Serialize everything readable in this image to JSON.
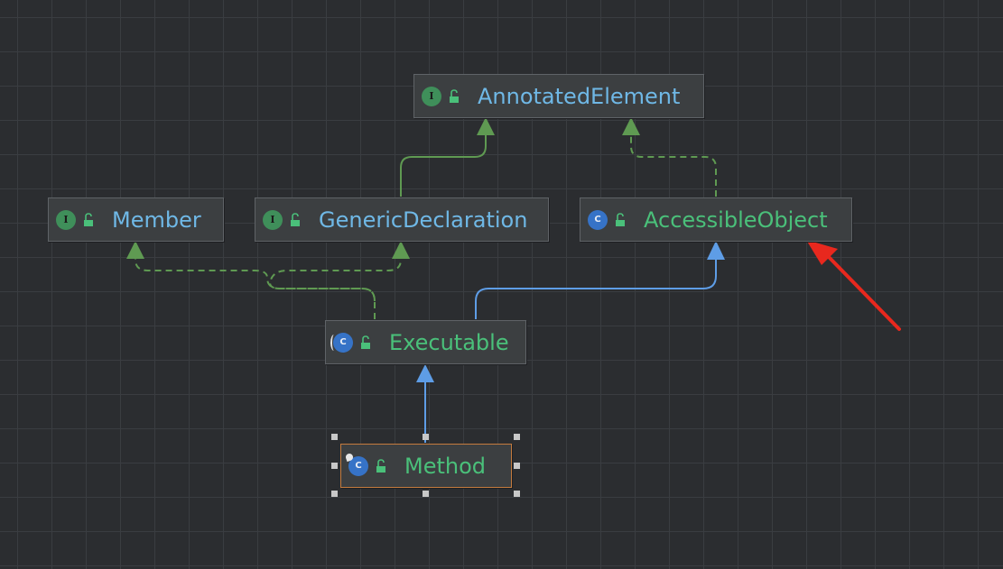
{
  "diagram": {
    "nodes": [
      {
        "id": "annotated-element",
        "kind": "interface",
        "label": "AnnotatedElement",
        "badge": "I"
      },
      {
        "id": "member",
        "kind": "interface",
        "label": "Member",
        "badge": "I"
      },
      {
        "id": "generic-declaration",
        "kind": "interface",
        "label": "GenericDeclaration",
        "badge": "I"
      },
      {
        "id": "accessible-object",
        "kind": "class",
        "label": "AccessibleObject",
        "badge": "C"
      },
      {
        "id": "executable",
        "kind": "abstract-class",
        "label": "Executable",
        "badge": "C"
      },
      {
        "id": "method",
        "kind": "final-class",
        "label": "Method",
        "badge": "C",
        "selected": true
      }
    ],
    "edges": [
      {
        "from": "generic-declaration",
        "to": "annotated-element",
        "type": "extends-interface"
      },
      {
        "from": "accessible-object",
        "to": "annotated-element",
        "type": "implements"
      },
      {
        "from": "executable",
        "to": "member",
        "type": "implements"
      },
      {
        "from": "executable",
        "to": "generic-declaration",
        "type": "implements"
      },
      {
        "from": "executable",
        "to": "accessible-object",
        "type": "extends-class"
      },
      {
        "from": "method",
        "to": "executable",
        "type": "extends-class"
      }
    ]
  },
  "colors": {
    "background": "#2b2d30",
    "grid": "#3a3d41",
    "interface_text": "#6fb8e6",
    "class_text": "#4ac07a",
    "interface_edge": "#5f9a52",
    "class_edge": "#5e9de6",
    "selection_border": "#c47b3e",
    "annotation_arrow": "#e8281e"
  },
  "icons": {
    "visibility": "unlock-icon",
    "annotation": "red-arrow-icon"
  }
}
